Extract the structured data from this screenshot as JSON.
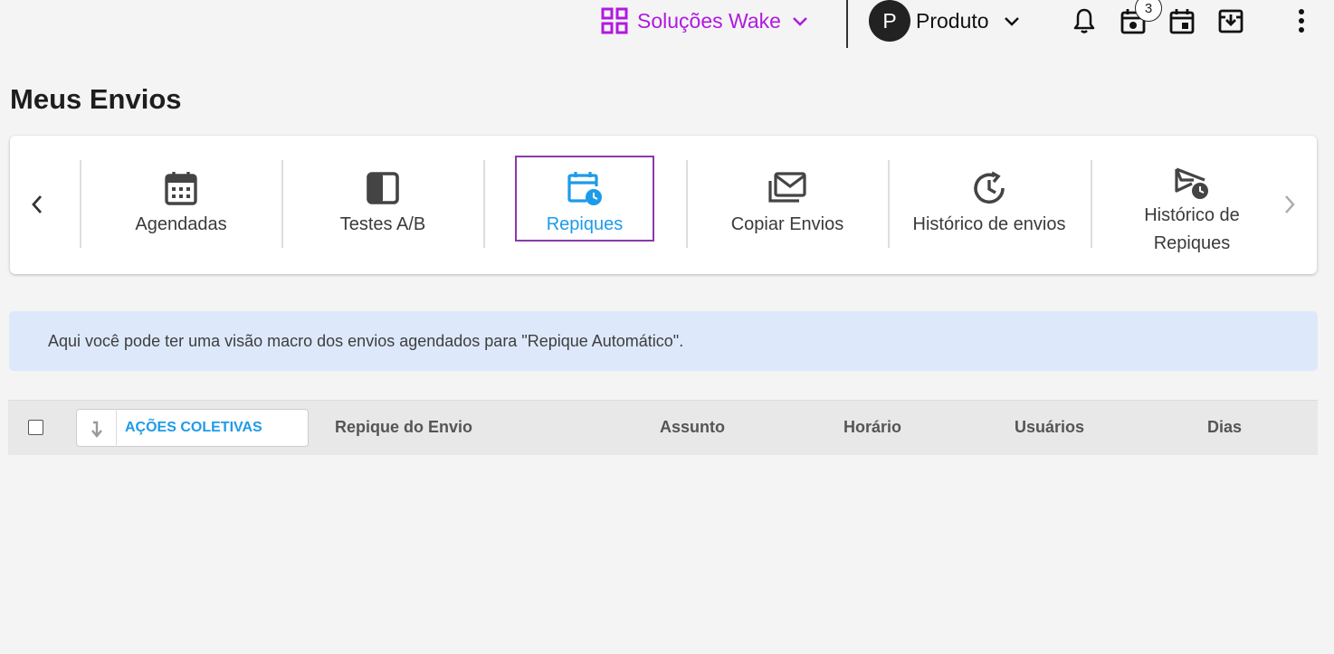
{
  "topbar": {
    "solutions_label": "Soluções Wake",
    "avatar_initial": "P",
    "product_label": "Produto",
    "badge_count": "3",
    "accent": "#b019e0"
  },
  "page": {
    "title": "Meus Envios"
  },
  "tabs": [
    {
      "label": "Agendadas",
      "icon": "calendar-grid-icon"
    },
    {
      "label": "Testes A/B",
      "icon": "split-square-icon"
    },
    {
      "label": "Repiques",
      "icon": "calendar-clock-icon",
      "active": true
    },
    {
      "label": "Copiar Envios",
      "icon": "mail-stack-icon"
    },
    {
      "label": "Histórico de envios",
      "icon": "history-icon"
    },
    {
      "label": "Histórico de Repiques",
      "icon": "send-clock-icon"
    }
  ],
  "info": {
    "text": "Aqui você pode ter uma visão macro dos envios agendados para \"Repique Automático\"."
  },
  "table": {
    "actions_label": "AÇÕES COLETIVAS",
    "columns": [
      "Repique do Envio",
      "Assunto",
      "Horário",
      "Usuários",
      "Dias"
    ]
  },
  "colors": {
    "active_tab": "#1e9be8",
    "active_border": "#8b3aa8",
    "info_bg": "#dde9fb"
  }
}
